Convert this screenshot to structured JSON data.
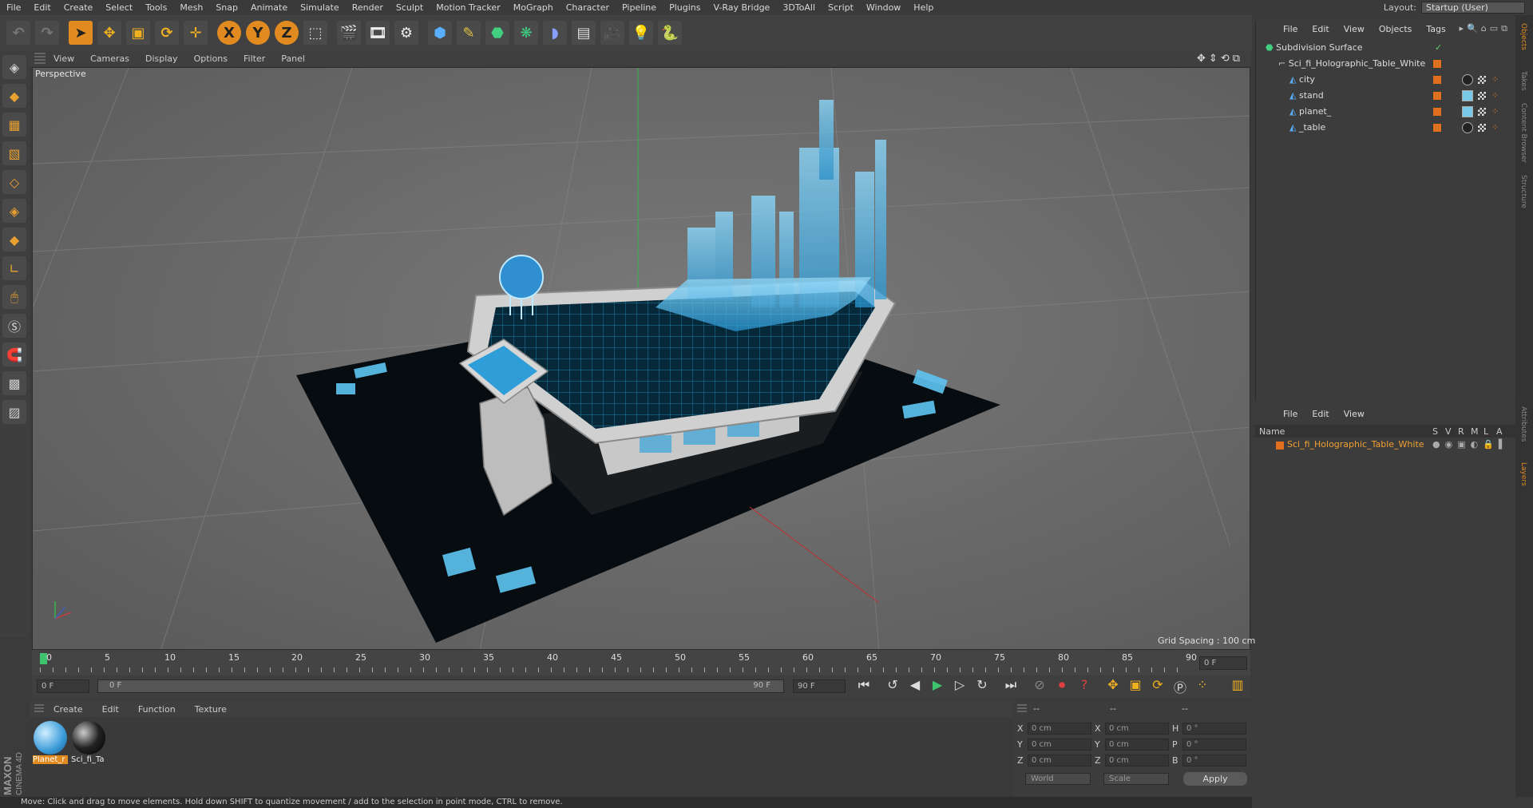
{
  "menubar": {
    "items": [
      "File",
      "Edit",
      "Create",
      "Select",
      "Tools",
      "Mesh",
      "Snap",
      "Animate",
      "Simulate",
      "Render",
      "Sculpt",
      "Motion Tracker",
      "MoGraph",
      "Character",
      "Pipeline",
      "Plugins",
      "V-Ray Bridge",
      "3DToAll",
      "Script",
      "Window",
      "Help"
    ],
    "layout_label": "Layout:",
    "layout_value": "Startup (User)"
  },
  "toolbar": {
    "axis_x": "X",
    "axis_y": "Y",
    "axis_z": "Z"
  },
  "viewport": {
    "menu": [
      "View",
      "Cameras",
      "Display",
      "Options",
      "Filter",
      "Panel"
    ],
    "label": "Perspective",
    "grid_spacing": "Grid Spacing : 100 cm"
  },
  "timeline": {
    "ticks": [
      "0",
      "5",
      "10",
      "15",
      "20",
      "25",
      "30",
      "35",
      "40",
      "45",
      "50",
      "55",
      "60",
      "65",
      "70",
      "75",
      "80",
      "85",
      "90"
    ],
    "current_frame": "0 F",
    "start_field": "0 F",
    "range_start": "0 F",
    "range_end": "90 F",
    "end_field": "90 F"
  },
  "material_manager": {
    "menu": [
      "Create",
      "Edit",
      "Function",
      "Texture"
    ],
    "materials": [
      {
        "label": "Planet_r",
        "color": "#3a9bd8"
      },
      {
        "label": "Sci_fi_Ta",
        "color": "#222222"
      }
    ]
  },
  "coords": {
    "header": [
      "--",
      "--",
      "--"
    ],
    "rows": [
      {
        "a": "X",
        "av": "0 cm",
        "b": "X",
        "bv": "0 cm",
        "c": "H",
        "cv": "0 °"
      },
      {
        "a": "Y",
        "av": "0 cm",
        "b": "Y",
        "bv": "0 cm",
        "c": "P",
        "cv": "0 °"
      },
      {
        "a": "Z",
        "av": "0 cm",
        "b": "Z",
        "bv": "0 cm",
        "c": "B",
        "cv": "0 °"
      }
    ],
    "world": "World",
    "scale": "Scale",
    "apply": "Apply"
  },
  "objects": {
    "menu": [
      "File",
      "Edit",
      "View",
      "Objects",
      "Tags"
    ],
    "items": [
      {
        "name": "Subdivision Surface",
        "indent": 0
      },
      {
        "name": "Sci_fi_Holographic_Table_White",
        "indent": 1
      },
      {
        "name": "city",
        "indent": 2
      },
      {
        "name": "stand",
        "indent": 2
      },
      {
        "name": "planet_",
        "indent": 2
      },
      {
        "name": "_table",
        "indent": 2
      }
    ]
  },
  "layers": {
    "menu": [
      "File",
      "Edit",
      "View"
    ],
    "name_header": "Name",
    "cols": [
      "S",
      "V",
      "R",
      "M",
      "L",
      "A"
    ],
    "items": [
      {
        "name": "Sci_fi_Holographic_Table_White",
        "color": "#e07020"
      }
    ]
  },
  "right_tabs": [
    "Objects",
    "Takes",
    "Content Browser",
    "Structure",
    "Attributes",
    "Layers"
  ],
  "status": "Move: Click and drag to move elements. Hold down SHIFT to quantize movement / add to the selection in point mode, CTRL to remove.",
  "brand": {
    "maxon": "MAXON",
    "cinema": "CINEMA 4D"
  }
}
